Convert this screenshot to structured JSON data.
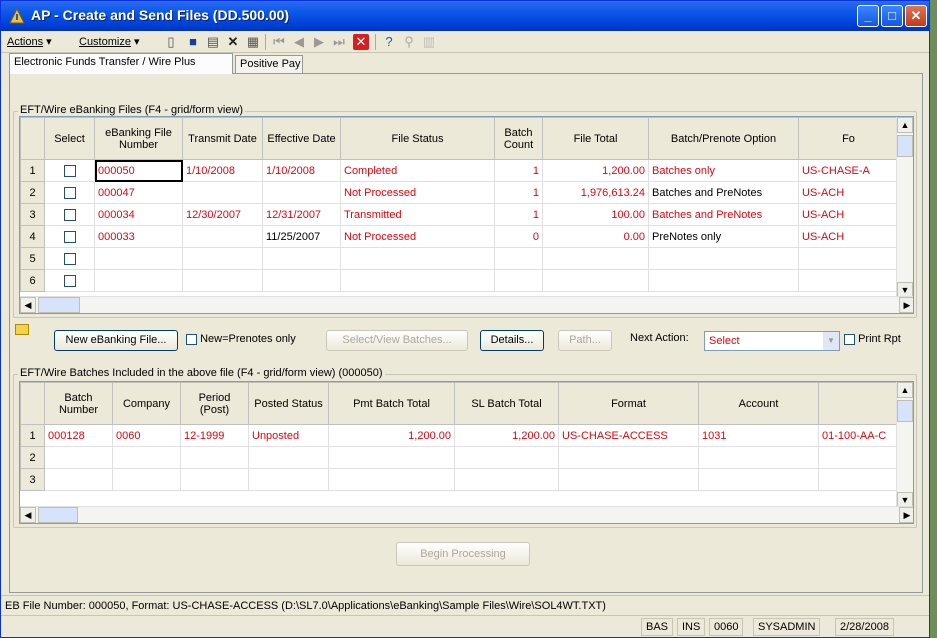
{
  "window": {
    "title": "AP - Create and Send Files (DD.500.00)"
  },
  "menu": {
    "actions": "Actions",
    "customize": "Customize"
  },
  "tabs": [
    {
      "label": "Electronic Funds Transfer / Wire Plus"
    },
    {
      "label": "Positive Pay"
    }
  ],
  "files_grid": {
    "title": "EFT/Wire eBanking Files (F4 - grid/form view)",
    "columns": [
      "Select",
      "eBanking File Number",
      "Transmit Date",
      "Effective Date",
      "File Status",
      "Batch Count",
      "File Total",
      "Batch/Prenote Option",
      "Fo"
    ],
    "rows": [
      {
        "n": "1",
        "file": "000050",
        "transmit": "1/10/2008",
        "effective": "1/10/2008",
        "status": "Completed",
        "count": "1",
        "total": "1,200.00",
        "option": "Batches only",
        "format": "US-CHASE-A"
      },
      {
        "n": "2",
        "file": "000047",
        "transmit": "",
        "effective": "",
        "status": "Not Processed",
        "count": "1",
        "total": "1,976,613.24",
        "option": "Batches and PreNotes",
        "format": "US-ACH"
      },
      {
        "n": "3",
        "file": "000034",
        "transmit": "12/30/2007",
        "effective": "12/31/2007",
        "status": "Transmitted",
        "count": "1",
        "total": "100.00",
        "option": "Batches and PreNotes",
        "format": "US-ACH"
      },
      {
        "n": "4",
        "file": "000033",
        "transmit": "",
        "effective": "11/25/2007",
        "status": "Not Processed",
        "count": "0",
        "total": "0.00",
        "option": "PreNotes only",
        "format": "US-ACH"
      },
      {
        "n": "5",
        "file": "",
        "transmit": "",
        "effective": "",
        "status": "",
        "count": "",
        "total": "",
        "option": "",
        "format": ""
      },
      {
        "n": "6",
        "file": "",
        "transmit": "",
        "effective": "",
        "status": "",
        "count": "",
        "total": "",
        "option": "",
        "format": ""
      }
    ]
  },
  "actions_bar": {
    "new_file": "New eBanking File...",
    "prenotes_only": "New=Prenotes only",
    "select_view": "Select/View Batches...",
    "details": "Details...",
    "path": "Path...",
    "next_action_label": "Next Action:",
    "next_action_value": "Select",
    "print_rpt": "Print Rpt"
  },
  "batches_grid": {
    "title": "EFT/Wire Batches Included in the above file (F4 - grid/form view) (000050)",
    "columns": [
      "Batch Number",
      "Company",
      "Period (Post)",
      "Posted Status",
      "Pmt Batch Total",
      "SL Batch Total",
      "Format",
      "Account",
      ""
    ],
    "rows": [
      {
        "n": "1",
        "batch": "000128",
        "company": "0060",
        "period": "12-1999",
        "posted": "Unposted",
        "pmt": "1,200.00",
        "sl": "1,200.00",
        "format": "US-CHASE-ACCESS",
        "account": "1031",
        "extra": "01-100-AA-C"
      },
      {
        "n": "2",
        "batch": "",
        "company": "",
        "period": "",
        "posted": "",
        "pmt": "",
        "sl": "",
        "format": "",
        "account": "",
        "extra": ""
      },
      {
        "n": "3",
        "batch": "",
        "company": "",
        "period": "",
        "posted": "",
        "pmt": "",
        "sl": "",
        "format": "",
        "account": "",
        "extra": ""
      }
    ]
  },
  "begin_processing": "Begin Processing",
  "status": {
    "message": "EB File Number: 000050, Format: US-CHASE-ACCESS (D:\\SL7.0\\Applications\\eBanking\\Sample Files\\Wire\\SOL4WT.TXT)",
    "panels": [
      "BAS",
      "INS",
      "0060",
      "SYSADMIN",
      "2/28/2008"
    ]
  },
  "colors": {
    "accent": "#0a56e8",
    "error_text": "#e8000b"
  }
}
